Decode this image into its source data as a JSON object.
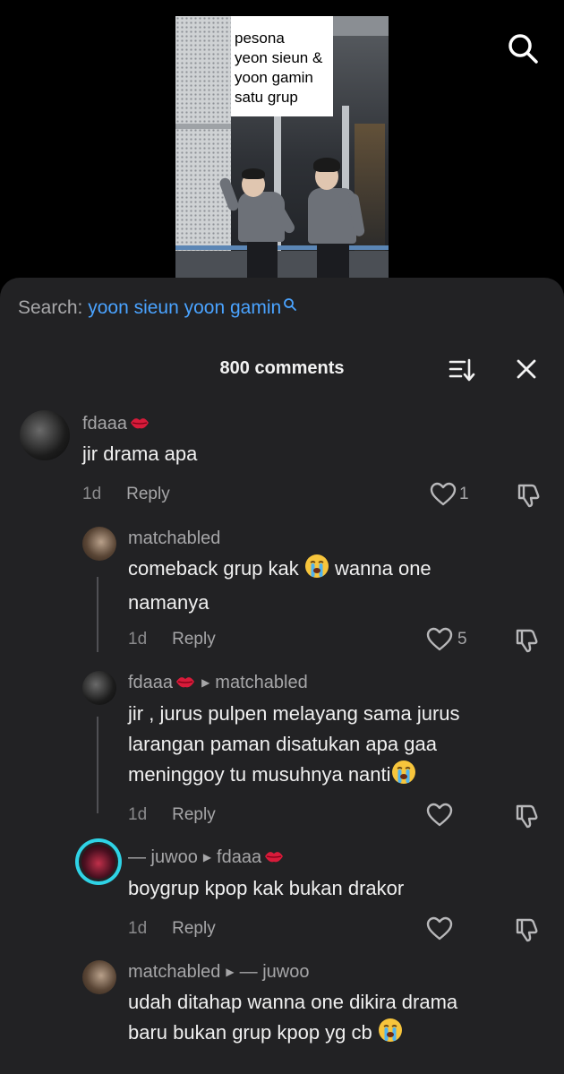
{
  "video": {
    "caption_lines": [
      "pesona",
      "yeon sieun &",
      "yoon gamin",
      "satu grup"
    ]
  },
  "search": {
    "label": "Search:",
    "query": "yoon sieun yoon gamin"
  },
  "header": {
    "comment_count": "800 comments"
  },
  "comments": [
    {
      "username": "fdaaa",
      "text_lines": [
        "jir drama apa"
      ],
      "time": "1d",
      "reply_label": "Reply",
      "likes": "1"
    },
    {
      "username": "matchabled",
      "text_lines": [
        "comeback grup kak",
        "wanna one",
        "namanya"
      ],
      "time": "1d",
      "reply_label": "Reply",
      "likes": "5"
    },
    {
      "username": "fdaaa",
      "reply_to": "matchabled",
      "text_lines": [
        "jir , jurus pulpen melayang sama jurus",
        "larangan paman disatukan apa gaa",
        "meninggoy tu musuhnya nanti"
      ],
      "time": "1d",
      "reply_label": "Reply",
      "likes": ""
    },
    {
      "username": "— juwoo",
      "reply_to": "fdaaa",
      "text_lines": [
        "boygrup kpop kak bukan drakor"
      ],
      "time": "1d",
      "reply_label": "Reply",
      "likes": ""
    },
    {
      "username": "matchabled",
      "reply_to": "— juwoo",
      "text_lines": [
        "udah ditahap wanna one dikira drama",
        "baru bukan grup kpop yg cb"
      ],
      "time": "",
      "reply_label": "",
      "likes": ""
    }
  ],
  "colors": {
    "sheet_bg": "#222224",
    "link_blue": "#4aa3ff",
    "story_ring": "#2fd3e6"
  }
}
